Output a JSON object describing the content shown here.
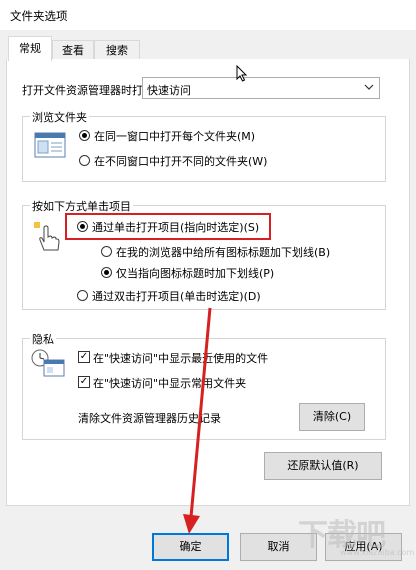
{
  "window": {
    "title": "文件夹选项"
  },
  "tabs": [
    {
      "label": "常规",
      "active": true
    },
    {
      "label": "查看",
      "active": false
    },
    {
      "label": "搜索",
      "active": false
    }
  ],
  "open_explorer": {
    "label": "打开文件资源管理器时打",
    "value": "快速访问"
  },
  "browse_folders": {
    "title": "浏览文件夹",
    "options": [
      {
        "label": "在同一窗口中打开每个文件夹(M)",
        "selected": true
      },
      {
        "label": "在不同窗口中打开不同的文件夹(W)",
        "selected": false
      }
    ]
  },
  "click_items": {
    "title": "按如下方式单击项目",
    "single_click": {
      "label": "通过单击打开项目(指向时选定)(S)",
      "selected": true
    },
    "sub_options": [
      {
        "label": "在我的浏览器中给所有图标标题加下划线(B)",
        "selected": false
      },
      {
        "label": "仅当指向图标标题时加下划线(P)",
        "selected": true
      }
    ],
    "double_click": {
      "label": "通过双击打开项目(单击时选定)(D)",
      "selected": false
    },
    "highlight_color": "#d72020"
  },
  "privacy": {
    "title": "隐私",
    "checks": [
      {
        "label": "在\"快速访问\"中显示最近使用的文件",
        "checked": true
      },
      {
        "label": "在\"快速访问\"中显示常用文件夹",
        "checked": true
      }
    ],
    "clear_label": "清除文件资源管理器历史记录",
    "clear_button": "清除(C)"
  },
  "restore_defaults": "还原默认值(R)",
  "footer": {
    "ok": "确定",
    "cancel": "取消",
    "apply": "应用(A)"
  },
  "watermark": {
    "text": "下载吧",
    "sub": "www.xiazaiba.com"
  },
  "colors": {
    "accent": "#0078d7",
    "annotation": "#d72020"
  }
}
